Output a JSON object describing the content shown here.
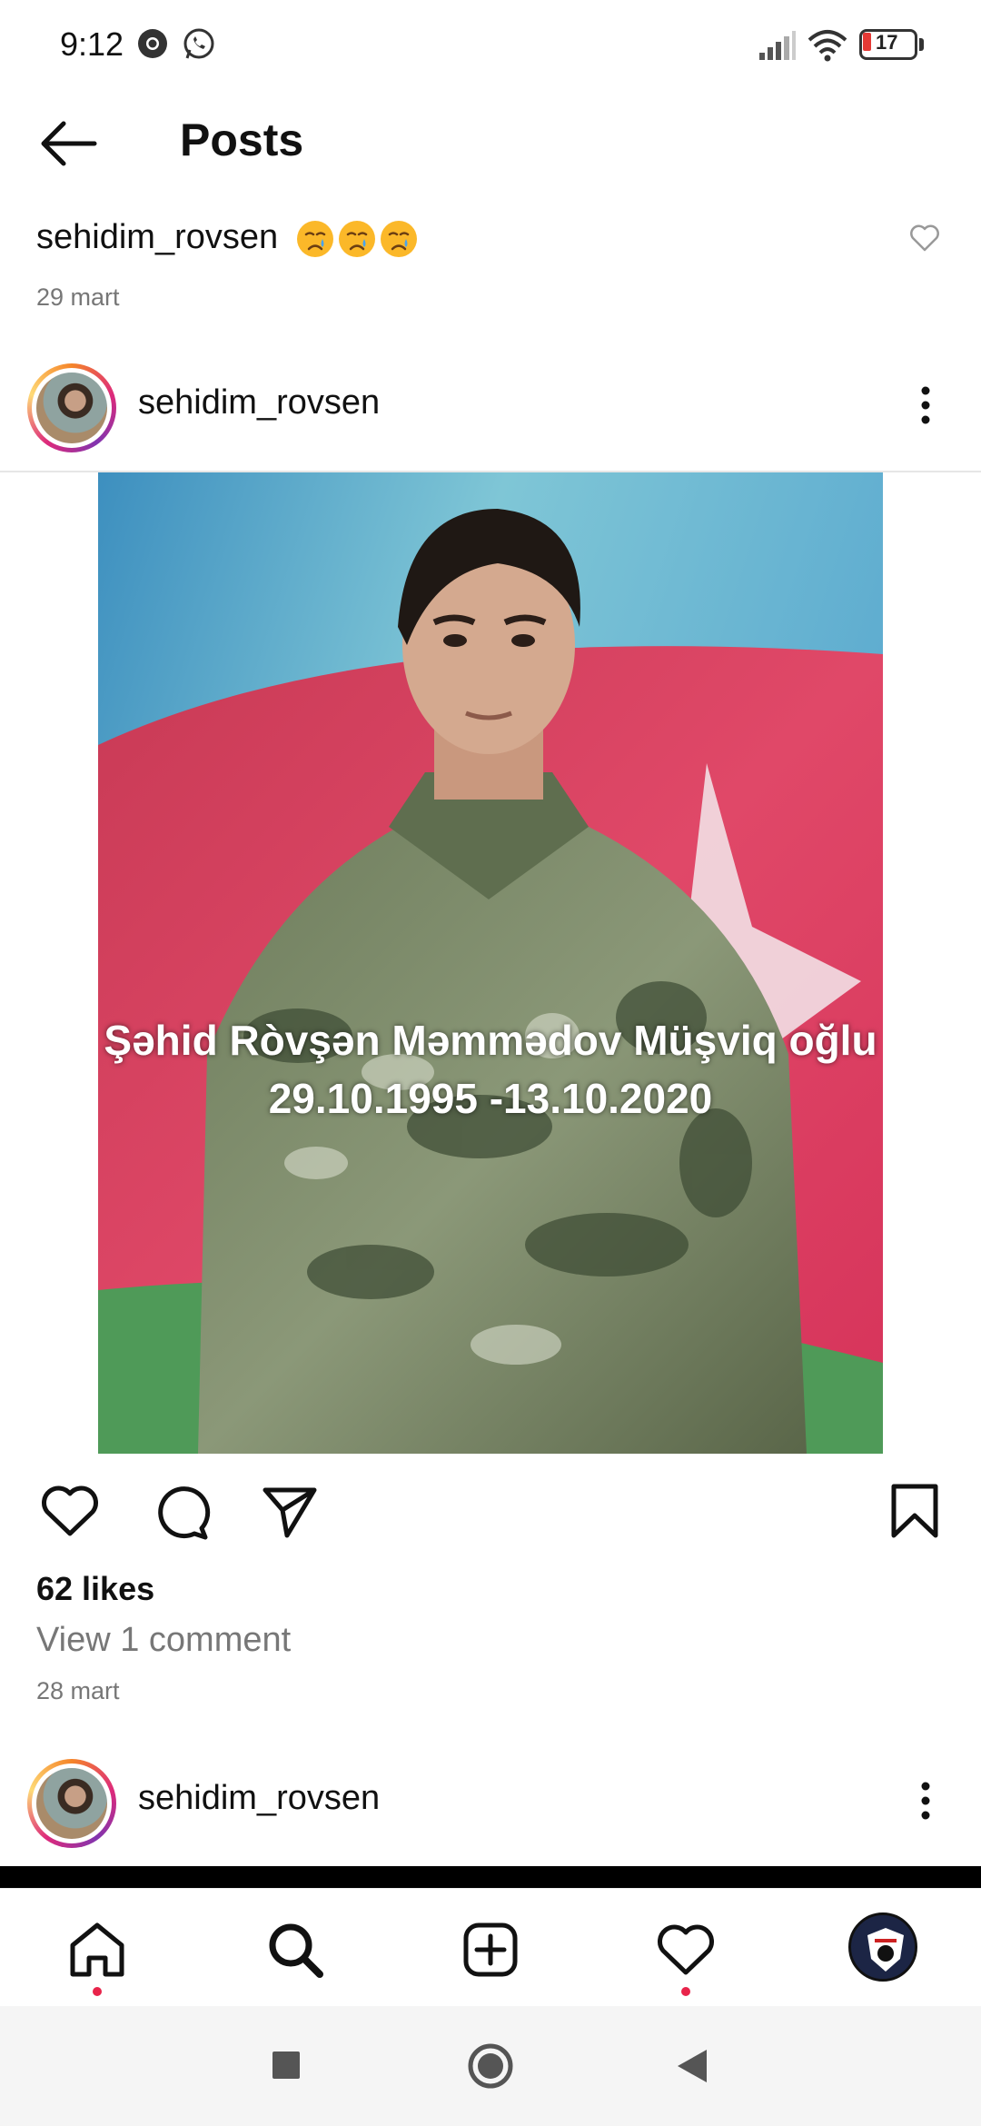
{
  "status_bar": {
    "time": "9:12",
    "battery": "17",
    "icons": [
      "chrome-icon",
      "whatsapp-icon",
      "signal-icon",
      "wifi-icon",
      "battery-icon"
    ]
  },
  "header": {
    "title": "Posts",
    "back_icon": "arrow-left-icon"
  },
  "caption": {
    "username": "sehidim_rovsen",
    "emojis": [
      "crying-face",
      "crying-face",
      "crying-face"
    ],
    "date": "29 mart"
  },
  "posts": [
    {
      "username": "sehidim_rovsen",
      "image": {
        "text_line1": "Şəhid Ròvşən Məmmədov Müşviq oğlu",
        "text_line2": "29.10.1995  -13.10.2020"
      },
      "likes": "62 likes",
      "view_comments": "View 1 comment",
      "date": "28 mart"
    },
    {
      "username": "sehidim_rovsen"
    }
  ],
  "bottom_nav": [
    "home-icon",
    "search-icon",
    "new-post-icon",
    "activity-heart-icon",
    "profile-avatar"
  ],
  "system_nav": [
    "recents-square",
    "home-circle",
    "back-triangle"
  ],
  "colors": {
    "accent_dot": "#e8244a",
    "secondary_text": "#777777"
  }
}
